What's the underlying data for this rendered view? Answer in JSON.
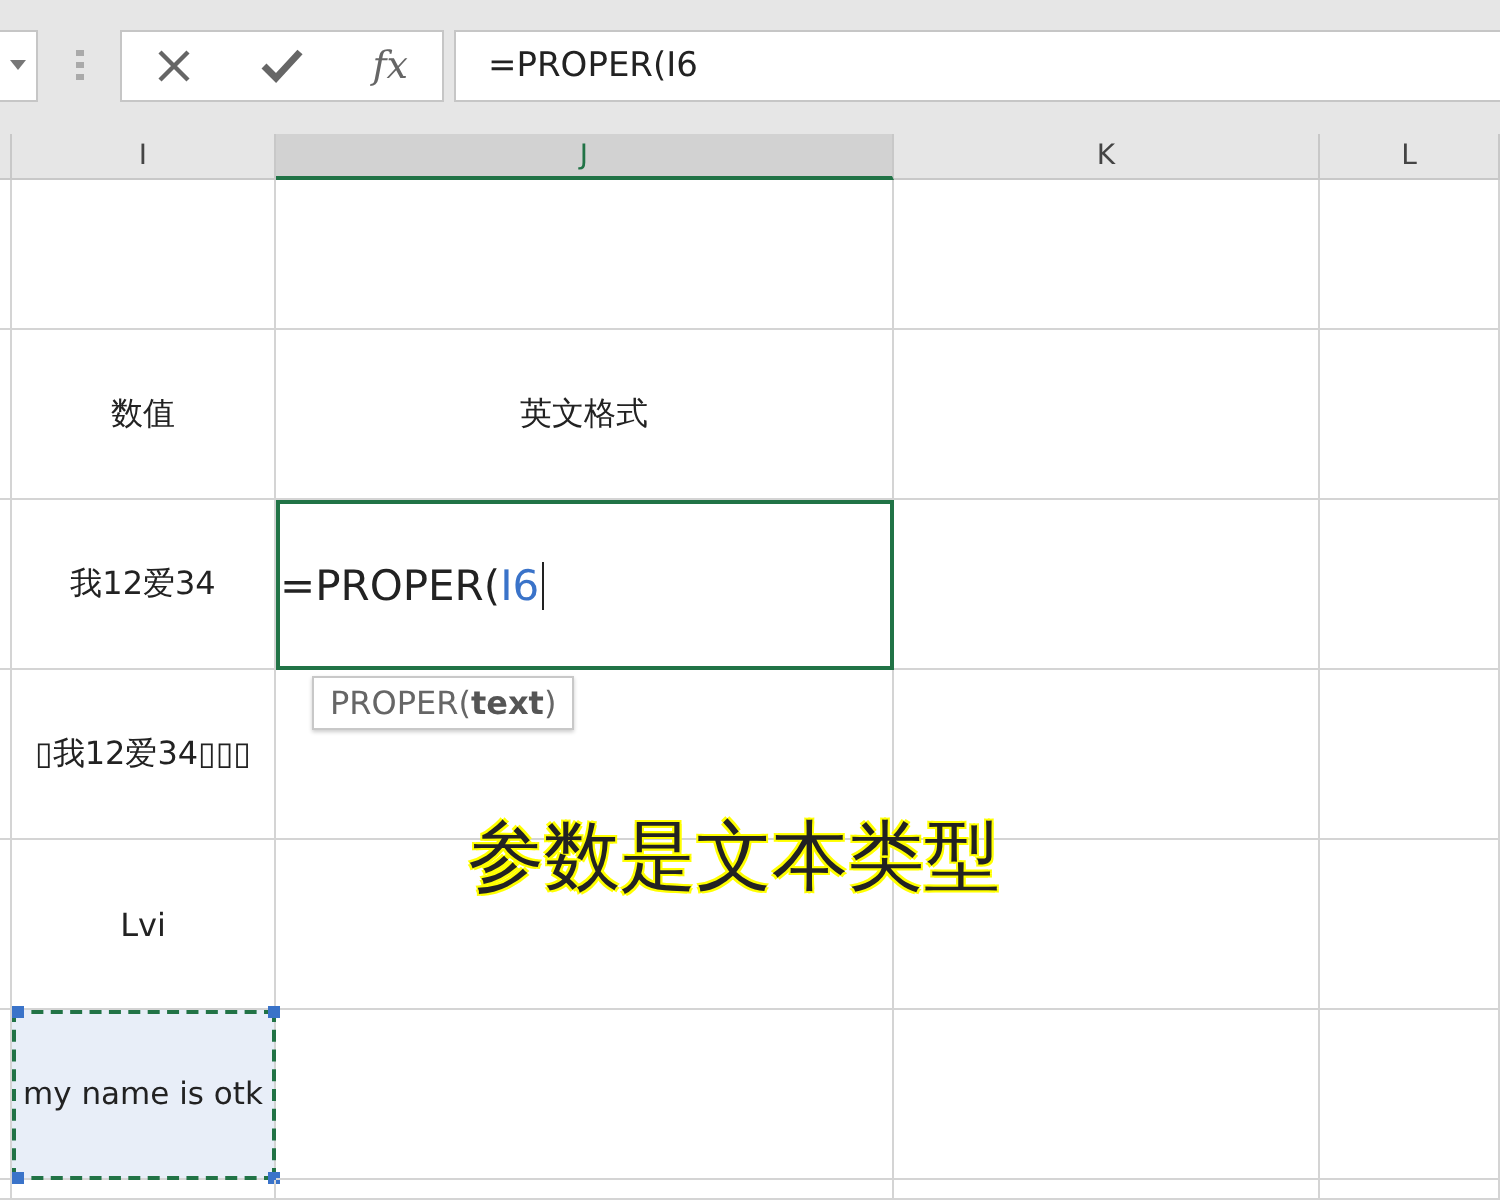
{
  "formula_bar": {
    "fx": "fx",
    "value": "=PROPER(I6"
  },
  "columns": [
    {
      "label": "I",
      "selected": false
    },
    {
      "label": "J",
      "selected": true
    },
    {
      "label": "K",
      "selected": false
    },
    {
      "label": "L",
      "selected": false
    }
  ],
  "rows": [
    {
      "cells": [
        {
          "text": ""
        },
        {
          "text": ""
        }
      ]
    },
    {
      "cells": [
        {
          "text": "数值"
        },
        {
          "text": "英文格式"
        }
      ]
    },
    {
      "cells": [
        {
          "text": "我12爱34"
        },
        {
          "kind": "editing",
          "formula": "=PROPER(",
          "reference": "I6"
        }
      ]
    },
    {
      "cells": [
        {
          "text": "▯我12爱34▯▯▯"
        },
        {
          "text": ""
        }
      ]
    },
    {
      "cells": [
        {
          "text": "Lvi"
        },
        {
          "text": ""
        }
      ]
    },
    {
      "cells": [
        {
          "text": "my name is otk",
          "referenced": true
        },
        {
          "text": ""
        }
      ]
    }
  ],
  "tooltip": "PROPER(**text**)",
  "annotation": "参数是文本类型"
}
